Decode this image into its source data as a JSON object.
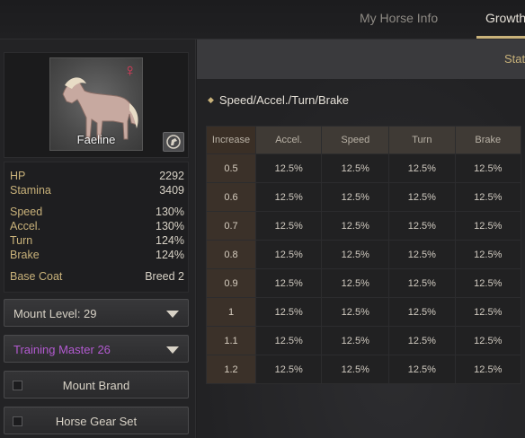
{
  "tabs": [
    {
      "label": "My Horse Info",
      "active": false
    },
    {
      "label": "Growth",
      "active": true
    }
  ],
  "subtab": "Stat",
  "horse": {
    "name": "Faeline",
    "gender_icon": "female-icon",
    "stats": [
      {
        "label": "HP",
        "value": "2292"
      },
      {
        "label": "Stamina",
        "value": "3409"
      },
      {
        "label": "Speed",
        "value": "130%"
      },
      {
        "label": "Accel.",
        "value": "130%"
      },
      {
        "label": "Turn",
        "value": "124%"
      },
      {
        "label": "Brake",
        "value": "124%"
      }
    ],
    "base_coat": {
      "label": "Base Coat",
      "value": "Breed 2"
    }
  },
  "controls": {
    "mount_level": "Mount Level: 29",
    "training_master": "Training Master 26",
    "mount_brand": "Mount Brand",
    "horse_gear_set": "Horse Gear Set"
  },
  "section_title": "Speed/Accel./Turn/Brake",
  "table": {
    "headers": [
      "Increase",
      "Accel.",
      "Speed",
      "Turn",
      "Brake"
    ],
    "rows": [
      [
        "0.5",
        "12.5%",
        "12.5%",
        "12.5%",
        "12.5%"
      ],
      [
        "0.6",
        "12.5%",
        "12.5%",
        "12.5%",
        "12.5%"
      ],
      [
        "0.7",
        "12.5%",
        "12.5%",
        "12.5%",
        "12.5%"
      ],
      [
        "0.8",
        "12.5%",
        "12.5%",
        "12.5%",
        "12.5%"
      ],
      [
        "0.9",
        "12.5%",
        "12.5%",
        "12.5%",
        "12.5%"
      ],
      [
        "1",
        "12.5%",
        "12.5%",
        "12.5%",
        "12.5%"
      ],
      [
        "1.1",
        "12.5%",
        "12.5%",
        "12.5%",
        "12.5%"
      ],
      [
        "1.2",
        "12.5%",
        "12.5%",
        "12.5%",
        "12.5%"
      ]
    ]
  },
  "colors": {
    "accent_gold": "#c9b27a",
    "training_purple": "#b25ad0",
    "female_pink": "#e23b5b"
  }
}
